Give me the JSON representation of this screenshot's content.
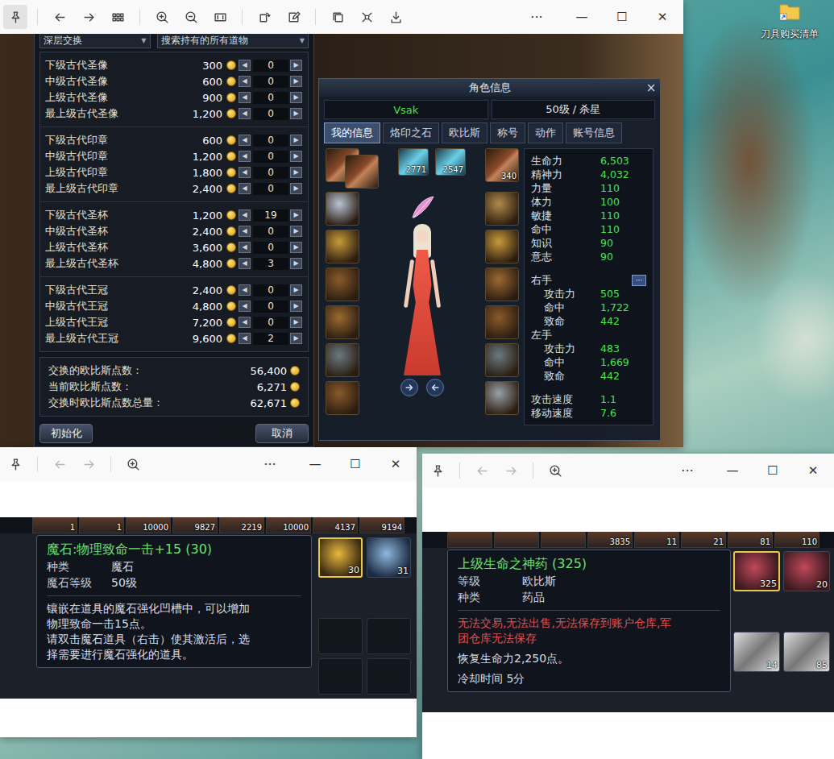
{
  "desktop": {
    "shortcut_label": "刀具购买清单"
  },
  "window_controls": {
    "more": "···",
    "minimize": "—",
    "maximize": "☐",
    "close": "✕"
  },
  "main_viewer": {
    "pinned": true,
    "nav_disabled": false,
    "exchange_panel": {
      "title": "深层交换",
      "filter": "搜索持有的所有道物",
      "dropdown_arrow": "▼",
      "stepper": {
        "decrease": "◀",
        "increase": "▶"
      },
      "groups": [
        [
          {
            "name": "下级古代圣像",
            "price": "300",
            "quantity": "0"
          },
          {
            "name": "中级古代圣像",
            "price": "600",
            "quantity": "0"
          },
          {
            "name": "上级古代圣像",
            "price": "900",
            "quantity": "0"
          },
          {
            "name": "最上级古代圣像",
            "price": "1,200",
            "quantity": "0"
          }
        ],
        [
          {
            "name": "下级古代印章",
            "price": "600",
            "quantity": "0"
          },
          {
            "name": "中级古代印章",
            "price": "1,200",
            "quantity": "0"
          },
          {
            "name": "上级古代印章",
            "price": "1,800",
            "quantity": "0"
          },
          {
            "name": "最上级古代印章",
            "price": "2,400",
            "quantity": "0"
          }
        ],
        [
          {
            "name": "下级古代圣杯",
            "price": "1,200",
            "quantity": "19"
          },
          {
            "name": "中级古代圣杯",
            "price": "2,400",
            "quantity": "0"
          },
          {
            "name": "上级古代圣杯",
            "price": "3,600",
            "quantity": "0"
          },
          {
            "name": "最上级古代圣杯",
            "price": "4,800",
            "quantity": "3"
          }
        ],
        [
          {
            "name": "下级古代王冠",
            "price": "2,400",
            "quantity": "0"
          },
          {
            "name": "中级古代王冠",
            "price": "4,800",
            "quantity": "0"
          },
          {
            "name": "上级古代王冠",
            "price": "7,200",
            "quantity": "0"
          },
          {
            "name": "最上级古代王冠",
            "price": "9,600",
            "quantity": "2"
          }
        ]
      ],
      "summary": [
        {
          "label": "交换的欧比斯点数 :",
          "value": "56,400"
        },
        {
          "label": "当前欧比斯点数 :",
          "value": "6,271"
        },
        {
          "label": "交换时欧比斯点数总量 :",
          "value": "62,671"
        }
      ],
      "buttons": [
        {
          "label": "初始化"
        },
        {
          "label": "取消"
        }
      ]
    },
    "character_panel": {
      "title": "角色信息",
      "close": "×",
      "name": "Vsak",
      "level_class": "50级 / 杀星",
      "tabs": [
        {
          "label": "我的信息",
          "selected": true
        },
        {
          "label": "烙印之石",
          "selected": false
        },
        {
          "label": "欧比斯",
          "selected": false
        },
        {
          "label": "称号",
          "selected": false
        },
        {
          "label": "动作",
          "selected": false
        },
        {
          "label": "账号信息",
          "selected": false
        }
      ],
      "ammo_counts": [
        "2771",
        "2547"
      ],
      "off_weapon_count": "340",
      "stats": [
        {
          "label": "生命力",
          "value": "6,503"
        },
        {
          "label": "精神力",
          "value": "4,032"
        },
        {
          "label": "力量",
          "value": "110"
        },
        {
          "label": "体力",
          "value": "100"
        },
        {
          "label": "敏捷",
          "value": "110"
        },
        {
          "label": "命中",
          "value": "110"
        },
        {
          "label": "知识",
          "value": "90"
        },
        {
          "label": "意志",
          "value": "90"
        }
      ],
      "more": "···",
      "hands": [
        {
          "label": "右手",
          "rows": [
            {
              "label": "攻击力",
              "value": "505"
            },
            {
              "label": "命中",
              "value": "1,722"
            },
            {
              "label": "致命",
              "value": "442"
            }
          ]
        },
        {
          "label": "左手",
          "rows": [
            {
              "label": "攻击力",
              "value": "483"
            },
            {
              "label": "命中",
              "value": "1,669"
            },
            {
              "label": "致命",
              "value": "442"
            }
          ]
        }
      ],
      "speeds": [
        {
          "label": "攻击速度",
          "value": "1.1"
        },
        {
          "label": "移动速度",
          "value": "7.6"
        }
      ]
    }
  },
  "stone_viewer": {
    "pinned": false,
    "nav_disabled": true,
    "top_counts": [
      "1",
      "1",
      "10000",
      "9827",
      "2219",
      "10000",
      "4137",
      "9194"
    ],
    "slots": [
      {
        "count": "30",
        "selected": true
      },
      {
        "count": "31",
        "selected": false
      }
    ],
    "tooltip": {
      "title": "魔石:物理致命一击+15 (30)",
      "fields": [
        {
          "label": "种类",
          "value": "魔石"
        },
        {
          "label": "魔石等级",
          "value": "50级"
        }
      ],
      "description": [
        "镶嵌在道具的魔石强化凹槽中，可以增加",
        "物理致命一击15点。",
        "请双击魔石道具（右击）使其激活后，选",
        "择需要进行魔石强化的道具。"
      ]
    }
  },
  "potion_viewer": {
    "pinned": false,
    "nav_disabled": true,
    "top_counts": [
      "3835",
      "11",
      "21",
      "81",
      "110"
    ],
    "slots": [
      {
        "count": "325",
        "selected": true
      },
      {
        "count": "20",
        "selected": false
      },
      {
        "count": "14",
        "selected": false
      },
      {
        "count": "85",
        "selected": false
      }
    ],
    "tooltip": {
      "title": "上级生命之神药 (325)",
      "fields": [
        {
          "label": "等级",
          "value": "欧比斯"
        },
        {
          "label": "种类",
          "value": "药品"
        }
      ],
      "restriction": [
        "无法交易,无法出售,无法保存到账户仓库,军",
        "团仓库无法保存"
      ],
      "effect": "恢复生命力2,250点。",
      "cooldown": "冷却时间 5分"
    }
  }
}
